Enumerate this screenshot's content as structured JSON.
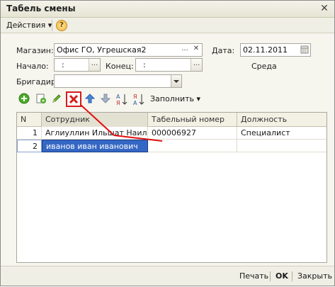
{
  "window": {
    "title": "Табель смены",
    "close_glyph": "✕"
  },
  "cmdbar": {
    "actions_label": "Действия ▾",
    "help_glyph": "?"
  },
  "form": {
    "store_label": "Магазин:",
    "store_value": "Офис ГО, Угрешская2",
    "store_btn": "...",
    "store_clear": "✕",
    "date_label": "Дата:",
    "date_value": "02.11.2011",
    "start_label": "Начало:",
    "start_value": ":",
    "start_btn": "...",
    "end_label": "Конец:",
    "end_value": ":",
    "end_btn": "...",
    "weekday": "Среда",
    "foreman_label": "Бригадир",
    "foreman_value": ""
  },
  "toolbar": {
    "fill_label": "Заполнить ▾",
    "icons": [
      "add-icon",
      "copy-icon",
      "edit-icon",
      "delete-icon",
      "move-up-icon",
      "move-down-icon",
      "sort-asc-icon",
      "sort-desc-icon"
    ]
  },
  "grid": {
    "columns": [
      "N",
      "Сотрудник",
      "Табельный номер",
      "Должность"
    ],
    "rows": [
      {
        "n": "1",
        "employee": "Аглиуллин Ильшат Наиле...",
        "tab_number": "000006927",
        "position": "Специалист"
      },
      {
        "n": "2",
        "employee": "иванов иван иванович",
        "tab_number": "",
        "position": ""
      }
    ]
  },
  "footer": {
    "print_label": "Печать",
    "ok_label": "OK",
    "close_label": "Закрыть"
  },
  "colors": {
    "highlight": "#3567c4",
    "delete_icon": "#d21d1d",
    "annotation_line": "#e01010"
  }
}
